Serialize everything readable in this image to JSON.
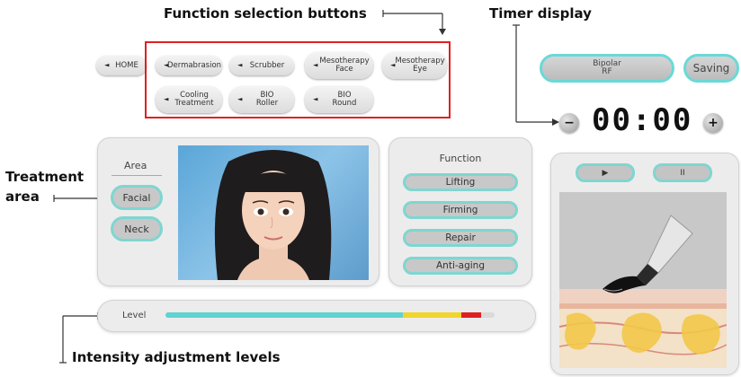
{
  "annotations": {
    "function_selection": "Function selection buttons",
    "timer_display": "Timer display",
    "treatment_area_line1": "Treatment",
    "treatment_area_line2": "area",
    "intensity_levels": "Intensity adjustment levels"
  },
  "nav": {
    "home": "HOME",
    "functions": [
      {
        "label": "Dermabrasion"
      },
      {
        "label": "Scrubber"
      },
      {
        "label": "Mesotherapy\nFace"
      },
      {
        "label": "Mesotherapy\nEye"
      },
      {
        "label": "Cooling\nTreatment"
      },
      {
        "label": "BIO\nRoller"
      },
      {
        "label": "BIO\nRound"
      }
    ],
    "arrow_icon": "◄"
  },
  "mode": {
    "bipolar": "Bipolar\nRF",
    "saving": "Saving"
  },
  "timer": {
    "value": "00:00",
    "minus": "−",
    "plus": "+"
  },
  "area": {
    "title": "Area",
    "options": [
      "Facial",
      "Neck"
    ]
  },
  "function_panel": {
    "title": "Function",
    "options": [
      "Lifting",
      "Firming",
      "Repair",
      "Anti-aging"
    ]
  },
  "level": {
    "label": "Level",
    "segments": {
      "cyan": 0.72,
      "yellow": 0.18,
      "red": 0.06
    }
  },
  "player": {
    "play": "▶",
    "pause": "II"
  },
  "colors": {
    "accent": "#6ad9d6",
    "highlight_border": "#e02020"
  }
}
